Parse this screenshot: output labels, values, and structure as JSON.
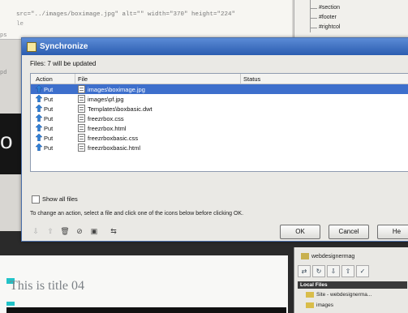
{
  "background": {
    "code_lines": [
      "src=\"../images/boximage.jpg\" alt=\"\" width=\"370\" height=\"224\"",
      "le"
    ],
    "gutter_texts": [
      "ps",
      "pd"
    ],
    "tree_items": [
      "#section",
      "#footer",
      "#rightcol"
    ],
    "left_big_text": "o",
    "doc_title": "This is title 04",
    "files_panel": {
      "site_name": "webdesignermag",
      "local_files": "Local Files",
      "rows": [
        "Site - webdesignerma...",
        "images"
      ]
    }
  },
  "dialog": {
    "title": "Synchronize",
    "files_count": "Files: 7 will be updated",
    "columns": {
      "action": "Action",
      "file": "File",
      "status": "Status"
    },
    "rows": [
      {
        "action": "Put",
        "file": "images\\boximage.jpg",
        "selected": true
      },
      {
        "action": "Put",
        "file": "images\\pf.jpg",
        "selected": false
      },
      {
        "action": "Put",
        "file": "Templates\\boxbasic.dwt",
        "selected": false
      },
      {
        "action": "Put",
        "file": "freezrbox.css",
        "selected": false
      },
      {
        "action": "Put",
        "file": "freezrbox.html",
        "selected": false
      },
      {
        "action": "Put",
        "file": "freezrboxbasic.css",
        "selected": false
      },
      {
        "action": "Put",
        "file": "freezrboxbasic.html",
        "selected": false
      }
    ],
    "show_all_files": "Show all files",
    "instructions": "To change an action, select a file and click one of the icons below before clicking OK.",
    "buttons": {
      "ok": "OK",
      "cancel": "Cancel",
      "help": "He"
    },
    "colors": {
      "title_bar": "#2b5db0",
      "selection": "#3d6fcc"
    }
  }
}
